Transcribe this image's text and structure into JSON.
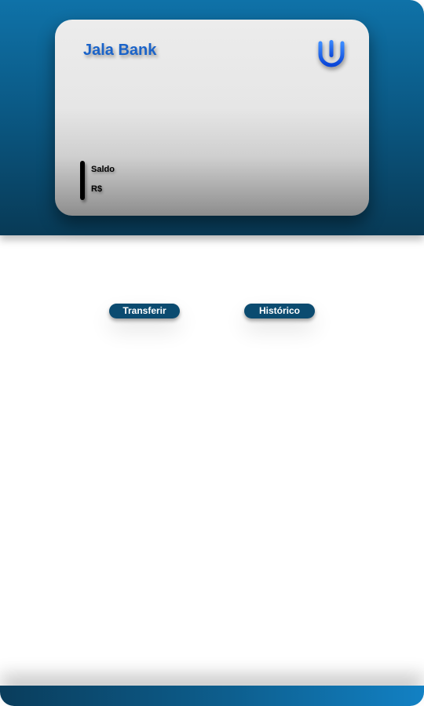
{
  "card": {
    "bank_name": "Jala Bank",
    "logo_icon": "bank-logo-icon",
    "balance_label": "Saldo",
    "currency": "R$"
  },
  "actions": {
    "transfer_label": "Transferir",
    "history_label": "Histórico"
  },
  "colors": {
    "primary_dark": "#0b4b70",
    "header_blue": "#0f72a8",
    "brand_text": "#1a63c9",
    "logo_blue": "#1f6fff"
  }
}
